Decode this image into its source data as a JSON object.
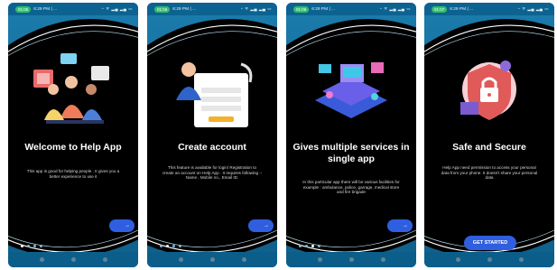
{
  "screens": [
    {
      "status": {
        "call": "01:05",
        "time": "6:29 PM | ...",
        "icons": "◔ ᯤ ▂▄ ▂▄ ▭"
      },
      "title": "Welcome to Help App",
      "body": "This app is good for helping people . It gives you a better experience to use it",
      "next_icon": "→"
    },
    {
      "status": {
        "call": "01:06",
        "time": "6:29 PM | ...",
        "icons": "◔ ᯤ ▂▄ ▂▄ ▭"
      },
      "title": "Create account",
      "body": "This feature is available for login/ Registration to create an account on Help App . It requires following :- Name , Mobile no., Email ID.",
      "next_icon": "→"
    },
    {
      "status": {
        "call": "01:06",
        "time": "6:29 PM | ...",
        "icons": "◔ ᯤ ▂▄ ▂▄ ▭"
      },
      "title": "Gives multiple services in single app",
      "body": "In this particular app there will be various facilities for example : ambulance, police, garrage, medical store and fire brigade",
      "next_icon": "→"
    },
    {
      "status": {
        "call": "01:07",
        "time": "6:29 PM | ...",
        "icons": "◔ ᯤ ▂▄ ▂▄ ▭"
      },
      "title": "Safe and Secure",
      "body": "Help App need permission to access your personal data from your phone. It doesn't share your personal data",
      "button": "GET STARTED"
    }
  ]
}
